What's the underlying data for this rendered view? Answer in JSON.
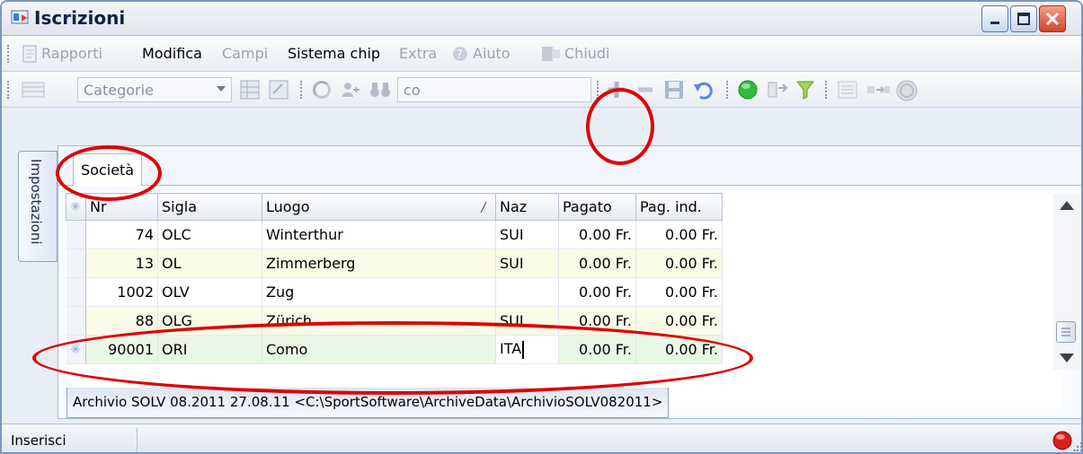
{
  "window": {
    "title": "Iscrizioni",
    "min_icon": "minimize-icon",
    "max_icon": "maximize-icon",
    "close_icon": "close-icon"
  },
  "menu": {
    "rapporti": "Rapporti",
    "modifica": "Modifica",
    "campi": "Campi",
    "sistema_chip": "Sistema chip",
    "extra": "Extra",
    "aiuto": "Aiuto",
    "chiudi": "Chiudi"
  },
  "toolbar": {
    "category_value": "Categorie",
    "search_value": "co"
  },
  "sidetab": {
    "label": "Impostazioni"
  },
  "tabs": [
    {
      "label": "Società"
    }
  ],
  "grid": {
    "columns": [
      "Nr",
      "Sigla",
      "Luogo",
      "Naz",
      "Pagato",
      "Pag. ind."
    ],
    "rows": [
      {
        "nr": "74",
        "sigla": "OLC",
        "luogo": "Winterthur",
        "naz": "SUI",
        "pagato": "0.00 Fr.",
        "pag_ind": "0.00 Fr."
      },
      {
        "nr": "13",
        "sigla": "OL",
        "luogo": "Zimmerberg",
        "naz": "SUI",
        "pagato": "0.00 Fr.",
        "pag_ind": "0.00 Fr."
      },
      {
        "nr": "1002",
        "sigla": "OLV",
        "luogo": "Zug",
        "naz": "",
        "pagato": "0.00 Fr.",
        "pag_ind": "0.00 Fr."
      },
      {
        "nr": "88",
        "sigla": "OLG",
        "luogo": "Zürich",
        "naz": "SUI",
        "pagato": "0.00 Fr.",
        "pag_ind": "0.00 Fr."
      },
      {
        "nr": "90001",
        "sigla": "ORI",
        "luogo": "Como",
        "naz": "ITA",
        "pagato": "0.00 Fr.",
        "pag_ind": "0.00 Fr."
      }
    ]
  },
  "archive": {
    "label": "Archivio SOLV 08.2011  27.08.11  <C:\\SportSoftware\\ArchiveData\\ArchivioSOLV082011>"
  },
  "status": {
    "mode": "Inserisci"
  },
  "colors": {
    "highlight_ring": "#e00000",
    "new_row": "#e9f8e6",
    "alt_row": "#fafbe6"
  }
}
